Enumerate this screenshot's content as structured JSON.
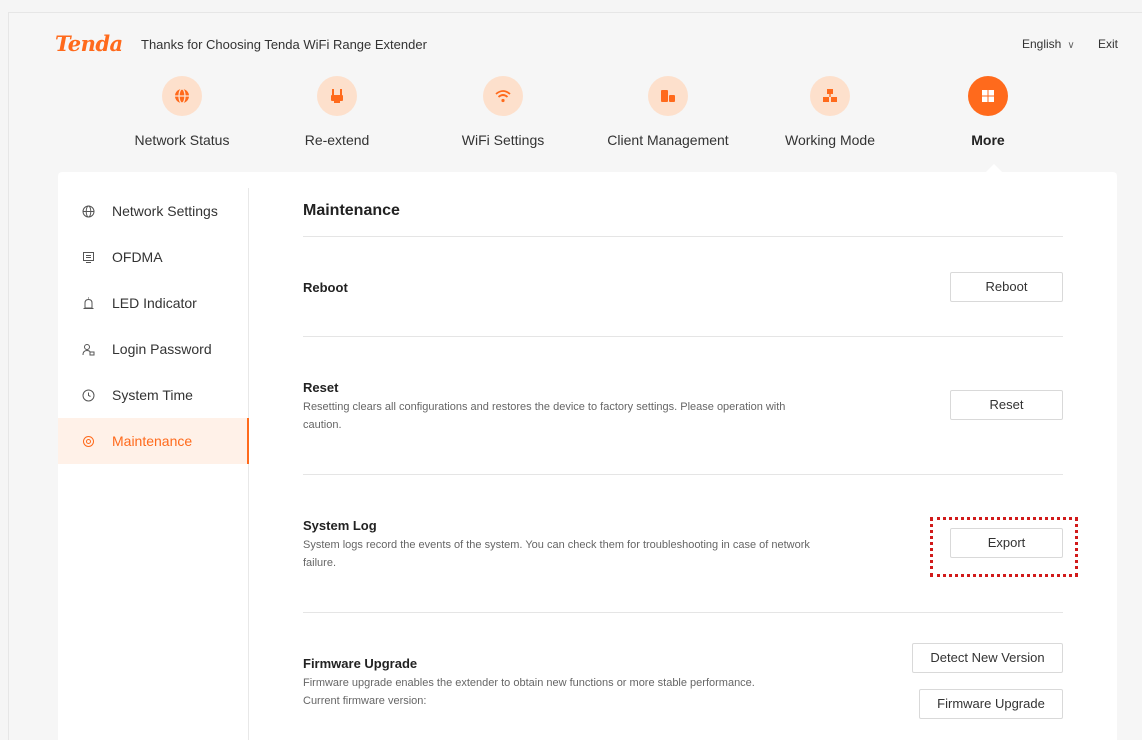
{
  "header": {
    "logo": "Tenda",
    "tagline": "Thanks for Choosing Tenda WiFi Range Extender",
    "language": "English",
    "exit": "Exit"
  },
  "nav": [
    {
      "label": "Network Status",
      "icon": "globe-icon"
    },
    {
      "label": "Re-extend",
      "icon": "extender-icon"
    },
    {
      "label": "WiFi Settings",
      "icon": "wifi-icon"
    },
    {
      "label": "Client Management",
      "icon": "clients-icon"
    },
    {
      "label": "Working Mode",
      "icon": "mode-icon"
    },
    {
      "label": "More",
      "icon": "more-icon",
      "active": true
    }
  ],
  "sidebar": [
    {
      "label": "Network Settings",
      "icon": "globe-icon"
    },
    {
      "label": "OFDMA",
      "icon": "monitor-icon"
    },
    {
      "label": "LED Indicator",
      "icon": "led-icon"
    },
    {
      "label": "Login Password",
      "icon": "user-lock-icon"
    },
    {
      "label": "System Time",
      "icon": "clock-icon"
    },
    {
      "label": "Maintenance",
      "icon": "maintenance-icon",
      "active": true
    }
  ],
  "content": {
    "title": "Maintenance",
    "reboot": {
      "title": "Reboot",
      "button": "Reboot"
    },
    "reset": {
      "title": "Reset",
      "desc": "Resetting clears all configurations and restores the device to factory settings. Please operation with caution.",
      "button": "Reset"
    },
    "syslog": {
      "title": "System Log",
      "desc": "System logs record the events of the system. You can check them for troubleshooting in case of network failure.",
      "button": "Export"
    },
    "firmware": {
      "title": "Firmware Upgrade",
      "desc1": "Firmware upgrade enables the extender to obtain new functions or more stable performance.",
      "desc2": "Current firmware version:",
      "detect_button": "Detect New Version",
      "upgrade_button": "Firmware Upgrade"
    }
  },
  "colors": {
    "accent": "#ff6a1c",
    "accent_light": "#fde0cc",
    "highlight": "#d11a1a"
  }
}
